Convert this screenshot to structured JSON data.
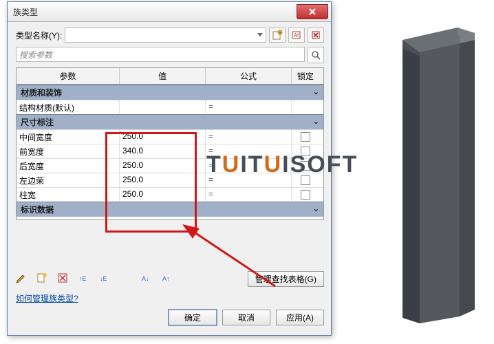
{
  "dialog": {
    "title": "族类型",
    "close_label": "X",
    "type_label": "类型名称(Y):",
    "search_placeholder": "搜索参数",
    "columns": {
      "param": "参数",
      "value": "值",
      "formula": "公式",
      "lock": "锁定"
    },
    "groups": {
      "materials": "材质和装饰",
      "dimensions": "尺寸标注",
      "identity": "标识数据"
    },
    "rows": {
      "struct_material": {
        "name": "结构材质(默认)",
        "value": "",
        "formula": "="
      },
      "middle_width": {
        "name": "中间宽度",
        "value": "250.0",
        "formula": "="
      },
      "front_width": {
        "name": "前宽度",
        "value": "340.0",
        "formula": "="
      },
      "rear_width": {
        "name": "后宽度",
        "value": "250.0",
        "formula": "="
      },
      "left_flange": {
        "name": "左边荣",
        "value": "250.0",
        "formula": "="
      },
      "col_width": {
        "name": "柱宽",
        "value": "250.0",
        "formula": "="
      }
    },
    "bottom_toolbar": {
      "manage_lookup": "管理查找表格(G)"
    },
    "help_link": "如何管理族类型?",
    "buttons": {
      "ok": "确定",
      "cancel": "取消",
      "apply": "应用(A)"
    }
  },
  "watermark": {
    "text_full": "TUITUISOFT"
  }
}
